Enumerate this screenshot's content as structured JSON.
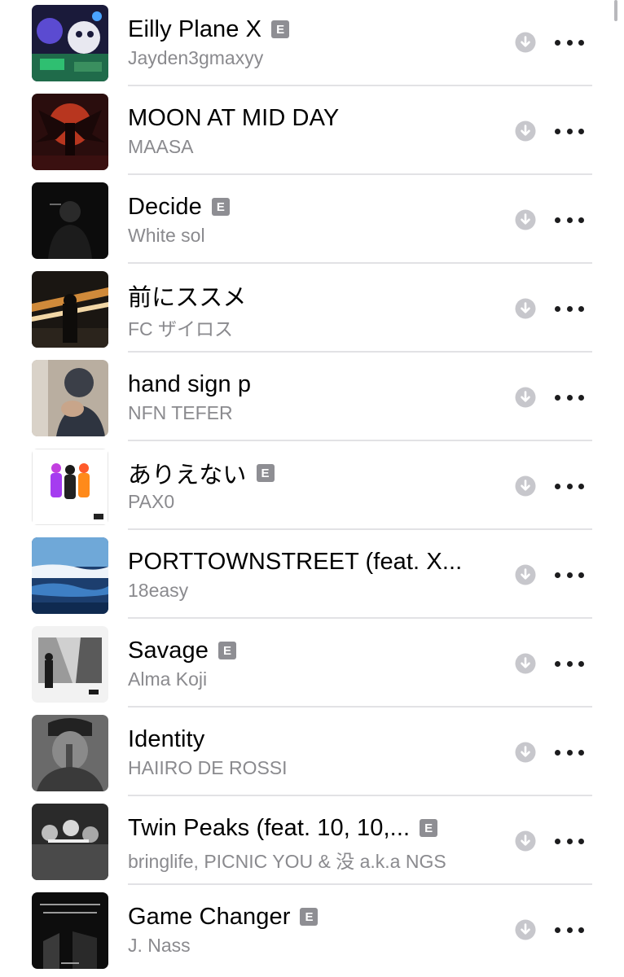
{
  "explicit_label": "E",
  "tracks": [
    {
      "title": "Eilly Plane X",
      "artist": "Jayden3gmaxyy",
      "explicit": true,
      "artwork": "cartoon-characters-artwork"
    },
    {
      "title": "MOON AT MID DAY",
      "artist": "MAASA",
      "explicit": false,
      "artwork": "winged-figure-red-moon-artwork"
    },
    {
      "title": "Decide",
      "artist": "White sol",
      "explicit": true,
      "artwork": "dark-hooded-figure-artwork"
    },
    {
      "title": "前にススメ",
      "artist": "FC ザイロス",
      "explicit": false,
      "artwork": "night-highway-artwork"
    },
    {
      "title": "hand sign p",
      "artist": "NFN TEFER",
      "explicit": false,
      "artwork": "hand-sign-photo-artwork"
    },
    {
      "title": "ありえない",
      "artist": "PAX0",
      "explicit": true,
      "artwork": "three-figures-white-artwork"
    },
    {
      "title": "PORTTOWNSTREET (feat. X...",
      "artist": "18easy",
      "explicit": false,
      "artwork": "harbor-painting-artwork"
    },
    {
      "title": "Savage",
      "artist": "Alma Koji",
      "explicit": true,
      "artwork": "monochrome-street-artwork"
    },
    {
      "title": "Identity",
      "artist": "HAIIRO DE ROSSI",
      "explicit": false,
      "artwork": "monochrome-portrait-artwork"
    },
    {
      "title": "Twin Peaks (feat. 10, 10,...",
      "artist": "bringlife, PICNIC YOU & 没 a.k.a NGS",
      "explicit": true,
      "artwork": "group-photo-artwork"
    },
    {
      "title": "Game Changer",
      "artist": "J. Nass",
      "explicit": true,
      "artwork": "game-changer-cover-artwork"
    }
  ],
  "colors": {
    "title": "#000000",
    "artist": "#8a8a8e",
    "explicit_badge": "#8e8e93",
    "download_icon": "#c7c7cc",
    "separator": "#e2e2e5"
  },
  "icons": {
    "download": "download-arrow-circle-icon",
    "more": "ellipsis-more-icon"
  }
}
